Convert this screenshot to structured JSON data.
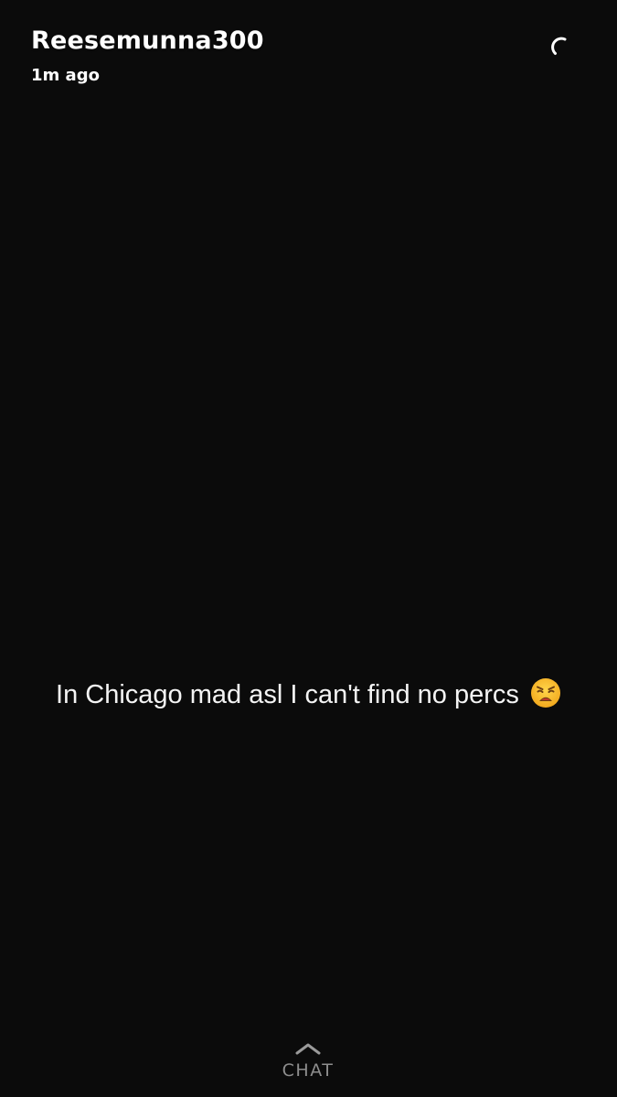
{
  "header": {
    "username": "Reesemunna300",
    "timestamp": "1m ago"
  },
  "timer": {
    "icon": "timer-icon"
  },
  "caption": {
    "text": "In Chicago mad asl I can't find no percs",
    "emoji": "weary-face-emoji"
  },
  "footer": {
    "chat_label": "CHAT",
    "icon": "chevron-up-icon"
  },
  "colors": {
    "background": "#0b0b0b",
    "text": "#ffffff",
    "footer_text": "#8e8e8e"
  }
}
